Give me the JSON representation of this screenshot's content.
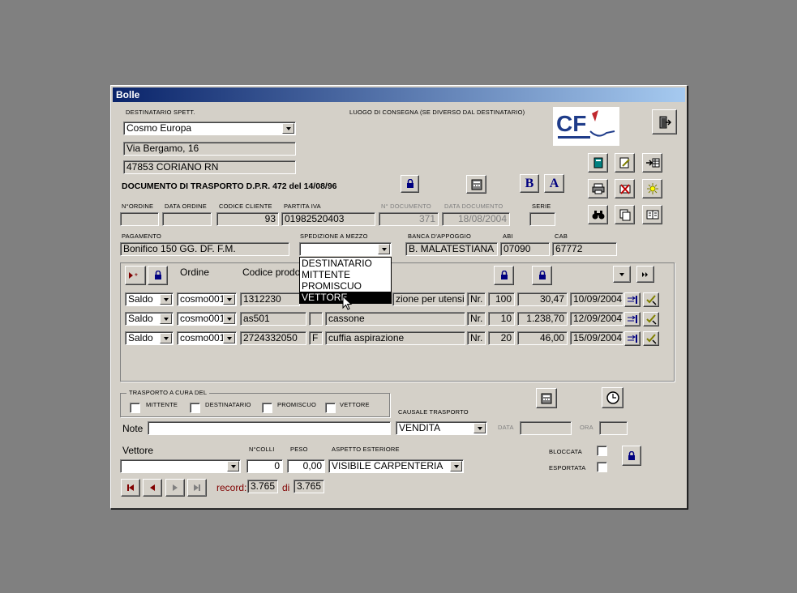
{
  "window": {
    "title": "Bolle"
  },
  "header": {
    "destinatario_label": "DESTINATARIO SPETT.",
    "destinatario_value": "Cosmo Europa",
    "address_line1": "Via Bergamo, 16",
    "address_line2": "47853 CORIANO RN",
    "luogo_label": "LUOGO DI CONSEGNA (SE DIVERSO DAL DESTINATARIO)",
    "logo_text": "CF",
    "doc_title": "DOCUMENTO DI TRASPORTO D.P.R. 472 del 14/08/96"
  },
  "fields": {
    "ordine_label": "N°ORDINE",
    "ordine_value": "",
    "data_ordine_label": "DATA ORDINE",
    "data_ordine_value": "",
    "codice_cliente_label": "CODICE CLIENTE",
    "codice_cliente_value": "93",
    "partita_iva_label": "PARTITA IVA",
    "partita_iva_value": "01982520403",
    "n_documento_label": "N° DOCUMENTO",
    "n_documento_value": "371",
    "data_documento_label": "DATA DOCUMENTO",
    "data_documento_value": "18/08/2004",
    "serie_label": "SERIE",
    "serie_value": "",
    "pagamento_label": "PAGAMENTO",
    "pagamento_value": "Bonifico 150 GG. DF. F.M.",
    "spedizione_label": "SPEDIZIONE A MEZZO",
    "spedizione_value": "",
    "banca_label": "BANCA D'APPOGGIO",
    "banca_value": "B. MALATESTIANA",
    "abi_label": "ABI",
    "abi_value": "07090",
    "cab_label": "CAB",
    "cab_value": "67772"
  },
  "dropdown": {
    "options": [
      "DESTINATARIO",
      "MITTENTE",
      "PROMISCUO",
      "VETTORE"
    ],
    "selected_index": 3
  },
  "grid": {
    "col_ordine": "Ordine",
    "col_codice": "Codice prodotto",
    "rows": [
      {
        "tipo": "Saldo",
        "ordine": "cosmo001",
        "codice": "1312230",
        "flag": "",
        "descrizione": "zione per utensile d",
        "um": "Nr.",
        "qta": "100",
        "prezzo": "30,47",
        "data": "10/09/2004"
      },
      {
        "tipo": "Saldo",
        "ordine": "cosmo001",
        "codice": "as501",
        "flag": "",
        "descrizione": "cassone",
        "um": "Nr.",
        "qta": "10",
        "prezzo": "1.238,70",
        "data": "12/09/2004"
      },
      {
        "tipo": "Saldo",
        "ordine": "cosmo001",
        "codice": "2724332050",
        "flag": "F",
        "descrizione": "cuffia aspirazione",
        "um": "Nr.",
        "qta": "20",
        "prezzo": "46,00",
        "data": "15/09/2004"
      }
    ]
  },
  "trasporto": {
    "group_label": "TRASPORTO A CURA DEL",
    "mittente": "MITTENTE",
    "destinatario": "DESTINATARIO",
    "promiscuo": "PROMISCUO",
    "vettore": "VETTORE",
    "causale_label": "CAUSALE TRASPORTO",
    "causale_value": "VENDITA",
    "data_label": "DATA",
    "data_value": "",
    "ora_label": "ORA",
    "ora_value": ""
  },
  "footer": {
    "note_label": "Note",
    "note_value": "",
    "vettore_label": "Vettore",
    "vettore_value": "",
    "colli_label": "N°COLLI",
    "colli_value": "0",
    "peso_label": "PESO",
    "peso_value": "0,00",
    "aspetto_label": "ASPETTO ESTERIORE",
    "aspetto_value": "VISIBILE CARPENTERIA",
    "bloccata_label": "BLOCCATA",
    "esportata_label": "ESPORTATA",
    "record_label": "record:",
    "record_current": "3.765",
    "record_of": "di",
    "record_total": "3.765"
  },
  "buttons": {
    "b_label": "B",
    "a_label": "A"
  },
  "colors": {
    "title_start": "#0a246a",
    "title_end": "#a6caf0",
    "face": "#d4d0c8",
    "record_red": "#800000",
    "lock_blue": "#000080"
  }
}
